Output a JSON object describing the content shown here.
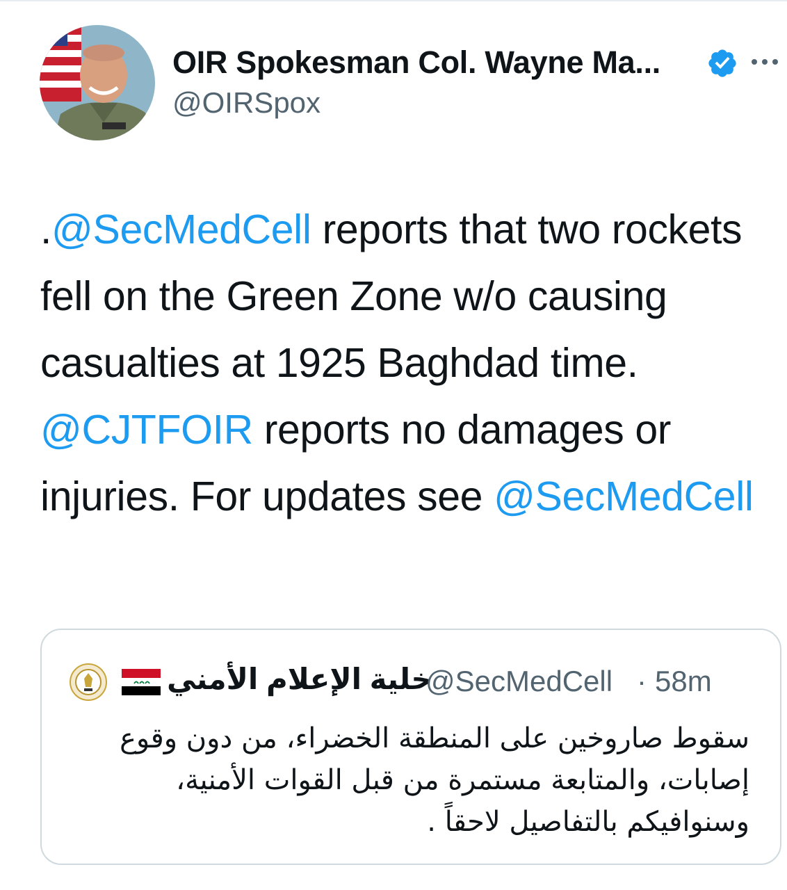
{
  "author": {
    "display_name": "OIR Spokesman Col. Wayne Ma...",
    "handle": "@OIRSpox",
    "verified": true,
    "avatar_icon": "profile-photo"
  },
  "tweet": {
    "parts": [
      {
        "text": ".",
        "type": "text"
      },
      {
        "text": "@SecMedCell",
        "type": "mention"
      },
      {
        "text": " reports that two rockets fell on the Green Zone w/o causing casualties at 1925 Baghdad time. ",
        "type": "text"
      },
      {
        "text": "@CJTFOIR",
        "type": "mention"
      },
      {
        "text": " reports no damages or injuries. For updates see ",
        "type": "text"
      },
      {
        "text": "@SecMedCell",
        "type": "mention"
      }
    ]
  },
  "quoted_tweet": {
    "display_name": "خلية الإعلام الأمني",
    "handle": "@SecMedCell",
    "separator": "·",
    "time": "58m",
    "text": "سقوط صاروخين على المنطقة الخضراء، من دون وقوع إصابات، والمتابعة مستمرة من قبل القوات الأمنية، وسنوافيكم بالتفاصيل لاحقاً ."
  },
  "colors": {
    "text": "#0f1419",
    "secondary": "#536471",
    "accent": "#1d9bf0",
    "border": "#cfd9de"
  }
}
